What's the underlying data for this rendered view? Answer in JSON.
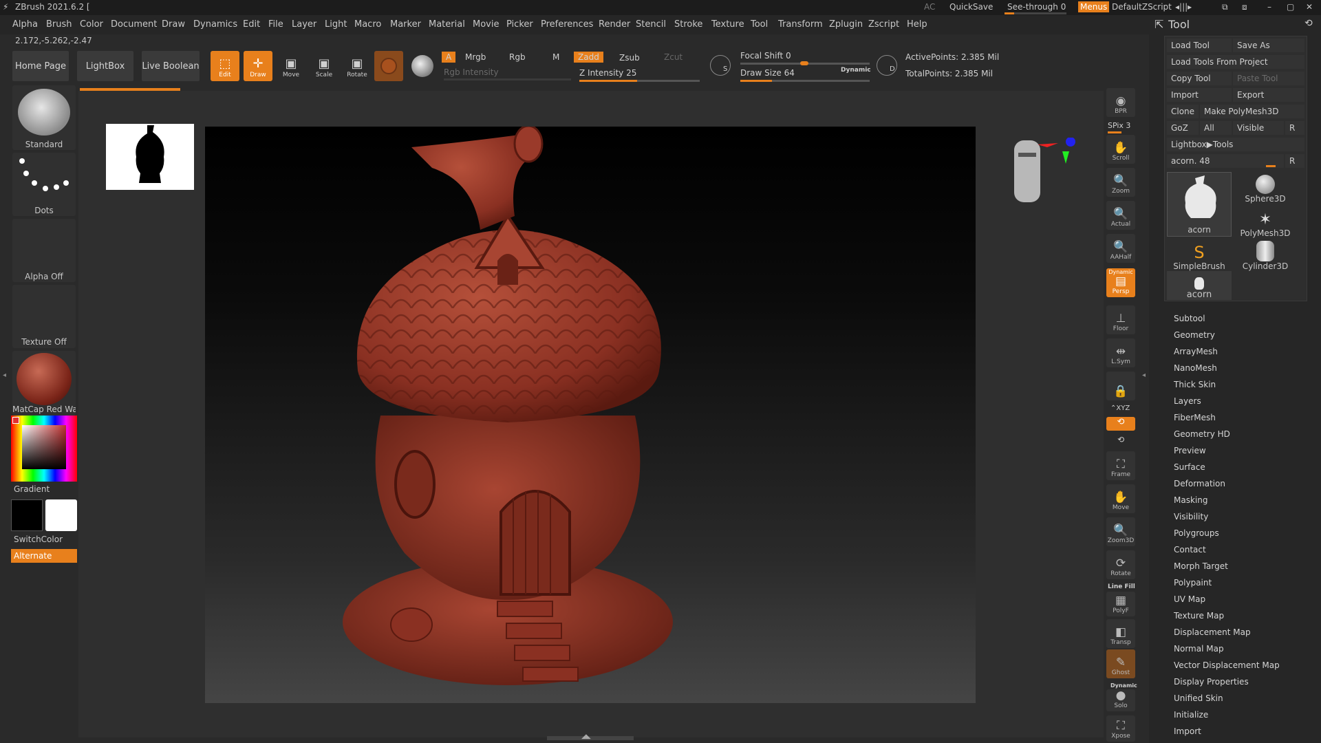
{
  "titlebar": {
    "app_title": "ZBrush 2021.6.2 [",
    "ac": "AC",
    "quicksave": "QuickSave",
    "see_through": "See-through",
    "see_through_value": "0",
    "menus": "Menus",
    "default_zscript": "DefaultZScript"
  },
  "menubar": [
    "Alpha",
    "Brush",
    "Color",
    "Document",
    "Draw",
    "Dynamics",
    "Edit",
    "File",
    "Layer",
    "Light",
    "Macro",
    "Marker",
    "Material",
    "Movie",
    "Picker",
    "Preferences",
    "Render",
    "Stencil",
    "Stroke",
    "Texture",
    "Tool",
    "Transform",
    "Zplugin",
    "Zscript",
    "Help"
  ],
  "coords": "2.172,-5.262,-2.47",
  "toolbar": {
    "home_page": "Home Page",
    "lightbox": "LightBox",
    "live_boolean": "Live Boolean",
    "edit": "Edit",
    "draw": "Draw",
    "move": "Move",
    "scale": "Scale",
    "rotate": "Rotate",
    "a": "A",
    "mrgb": "Mrgb",
    "rgb": "Rgb",
    "m": "M",
    "rgb_intensity": "Rgb Intensity",
    "zadd": "Zadd",
    "zsub": "Zsub",
    "zcut": "Zcut",
    "z_intensity_label": "Z Intensity",
    "z_intensity": "25",
    "focal_shift_label": "Focal Shift",
    "focal_shift": "0",
    "draw_size_label": "Draw Size",
    "draw_size": "64",
    "dynamic": "Dynamic",
    "active_points": "ActivePoints: 2.385 Mil",
    "total_points": "TotalPoints: 2.385 Mil",
    "s_label": "S",
    "d_label": "D"
  },
  "left_shelf": {
    "brush": "Standard",
    "stroke": "Dots",
    "alpha": "Alpha Off",
    "texture": "Texture Off",
    "material": "MatCap Red Wax",
    "gradient": "Gradient",
    "switch_color": "SwitchColor",
    "alternate": "Alternate"
  },
  "right_shelf": {
    "bpr": "BPR",
    "spix": "SPix 3",
    "scroll": "Scroll",
    "zoom": "Zoom",
    "actual": "Actual",
    "aahalf": "AAHalf",
    "dynamic": "Dynamic",
    "persp": "Persp",
    "floor": "Floor",
    "lsym": "L.Sym",
    "xyz": "⌃XYZ",
    "frame": "Frame",
    "move": "Move",
    "zoom3d": "Zoom3D",
    "rotate": "Rotate",
    "line_fill": "Line Fill",
    "polyf": "PolyF",
    "transp": "Transp",
    "ghost": "Ghost",
    "dynamic2": "Dynamic",
    "solo": "Solo",
    "xpose": "Xpose"
  },
  "tool_panel": {
    "title": "Tool",
    "load_tool": "Load Tool",
    "save_as": "Save As",
    "load_tools_from_project": "Load Tools From Project",
    "copy_tool": "Copy Tool",
    "paste_tool": "Paste Tool",
    "import": "Import",
    "export": "Export",
    "clone": "Clone",
    "make_polymesh": "Make PolyMesh3D",
    "goz": "GoZ",
    "all": "All",
    "visible": "Visible",
    "r": "R",
    "lightbox_tools": "Lightbox▶Tools",
    "acorn_slider_label": "acorn.",
    "acorn_slider_value": "48",
    "thumbs": [
      "acorn",
      "Sphere3D",
      "PolyMesh3D",
      "SimpleBrush",
      "Cylinder3D",
      "acorn"
    ],
    "sections": [
      "Subtool",
      "Geometry",
      "ArrayMesh",
      "NanoMesh",
      "Thick Skin",
      "Layers",
      "FiberMesh",
      "Geometry HD",
      "Preview",
      "Surface",
      "Deformation",
      "Masking",
      "Visibility",
      "Polygroups",
      "Contact",
      "Morph Target",
      "Polypaint",
      "UV Map",
      "Texture Map",
      "Displacement Map",
      "Normal Map",
      "Vector Displacement Map",
      "Display Properties",
      "Unified Skin",
      "Initialize",
      "Import"
    ]
  },
  "colors": {
    "accent": "#e8801c",
    "panel": "#262626",
    "model": "#9a3a2a"
  }
}
